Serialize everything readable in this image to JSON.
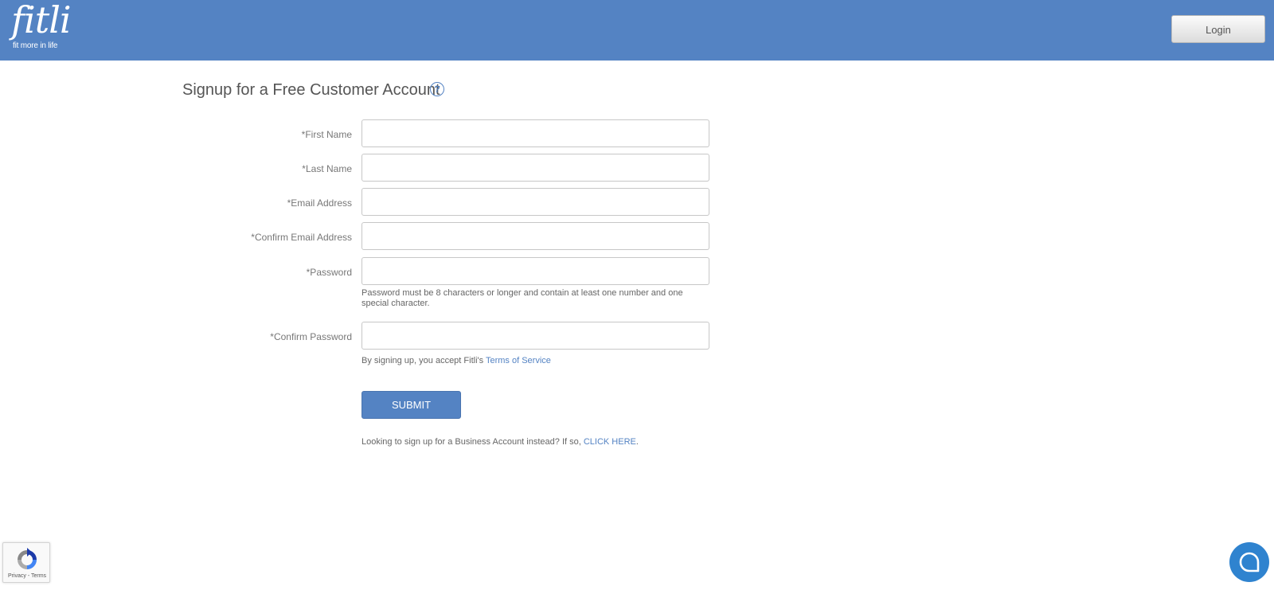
{
  "header": {
    "logo_word": "fitli",
    "logo_tagline": "fit more in life",
    "login_label": "Login"
  },
  "form": {
    "title": "Signup for a Free Customer Account",
    "help_glyph": "?",
    "fields": {
      "first_name": {
        "label": "*First Name",
        "value": ""
      },
      "last_name": {
        "label": "*Last Name",
        "value": ""
      },
      "email": {
        "label": "*Email Address",
        "value": ""
      },
      "confirm_email": {
        "label": "*Confirm Email Address",
        "value": ""
      },
      "password": {
        "label": "*Password",
        "value": ""
      },
      "confirm_password": {
        "label": "*Confirm Password",
        "value": ""
      }
    },
    "password_hint": "Password must be 8 characters or longer and contain at least one number and one special character.",
    "terms_prefix": "By signing up, you accept Fitli's ",
    "terms_link": "Terms of Service",
    "submit_label": "SUBMIT",
    "business_prefix": "Looking to sign up for a Business Account instead? If so, ",
    "business_link": "CLICK HERE",
    "business_suffix": "."
  },
  "recaptcha": {
    "links": "Privacy - Terms"
  },
  "colors": {
    "brand": "#5483c3",
    "chat": "#2f83cf"
  },
  "icons": {
    "help": "question-circle-icon",
    "recaptcha": "recaptcha-icon",
    "chat": "chat-bubble-icon"
  }
}
